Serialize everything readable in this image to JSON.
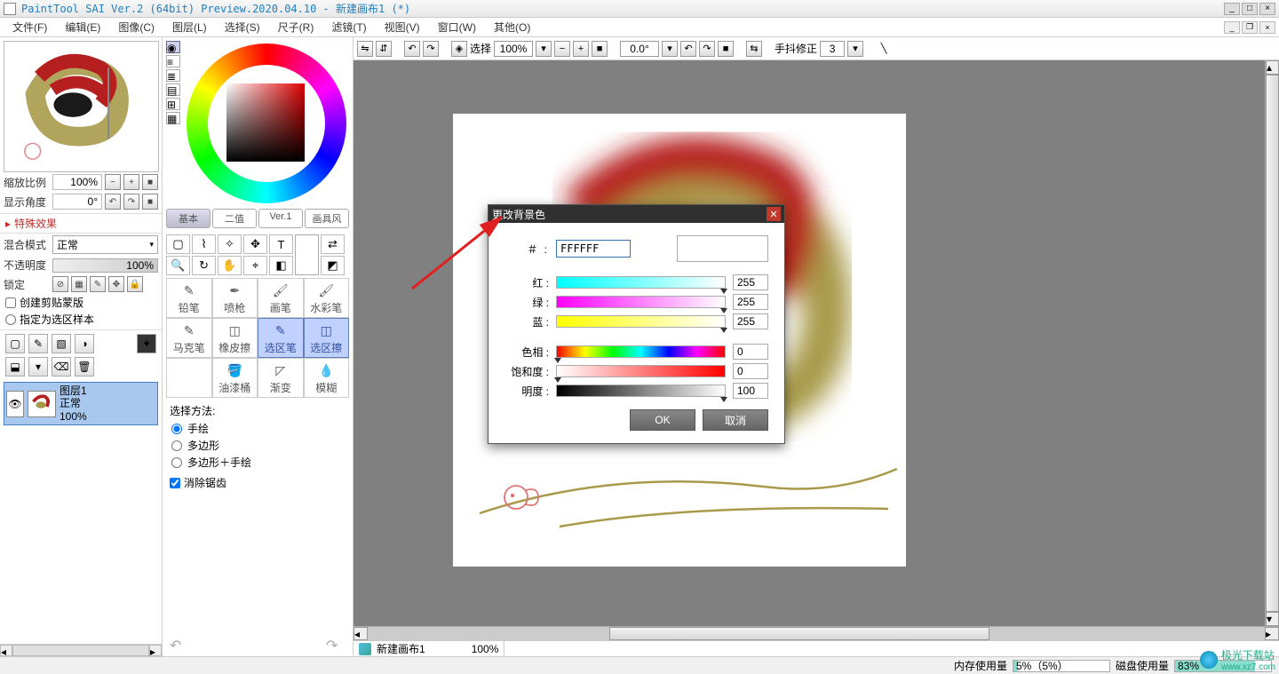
{
  "titlebar": {
    "title": "PaintTool SAI Ver.2 (64bit) Preview.2020.04.10 - 新建画布1 (*)"
  },
  "menu": {
    "file": "文件(F)",
    "edit": "编辑(E)",
    "image": "图像(C)",
    "layer": "图层(L)",
    "select": "选择(S)",
    "ruler": "尺子(R)",
    "filter": "滤镜(T)",
    "view": "视图(V)",
    "window": "窗口(W)",
    "others": "其他(O)"
  },
  "nav": {
    "zoom_label": "缩放比例",
    "zoom_value": "100%",
    "angle_label": "显示角度",
    "angle_value": "0°",
    "special_effects": "特殊效果",
    "blend_label": "混合模式",
    "blend_value": "正常",
    "opacity_label": "不透明度",
    "opacity_value": "100%",
    "lock_label": "锁定",
    "clip_label": "创建剪贴蒙版",
    "selsample_label": "指定为选区样本"
  },
  "layer": {
    "name": "图层1",
    "mode": "正常",
    "opacity": "100%"
  },
  "color_tabs": {
    "basic": "基本",
    "binary": "二值",
    "ver1": "Ver.1",
    "brushstyle": "画具风"
  },
  "brushes": {
    "r1": [
      "铅笔",
      "喷枪",
      "画笔",
      "水彩笔"
    ],
    "r2": [
      "马克笔",
      "橡皮擦",
      "选区笔",
      "选区擦"
    ],
    "r3": [
      "",
      "油漆桶",
      "渐变",
      "模糊"
    ]
  },
  "select": {
    "title": "选择方法:",
    "freehand": "手绘",
    "polygon": "多边形",
    "polyfh": "多边形＋手绘",
    "antialias": "消除锯齿"
  },
  "canvas_tb": {
    "select_label": "选择",
    "zoom": "100%",
    "angle": "0.0°",
    "stab_label": "手抖修正",
    "stab_value": "3"
  },
  "doc_tab": {
    "name": "新建画布1",
    "zoom": "100%"
  },
  "dialog": {
    "title": "更改背景色",
    "hash": "＃ :",
    "hex": "FFFFFF",
    "red": "红 :",
    "green": "绿 :",
    "blue": "蓝 :",
    "hue": "色相 :",
    "sat": "饱和度 :",
    "val": "明度 :",
    "r": "255",
    "g": "255",
    "b": "255",
    "h": "0",
    "s": "0",
    "v": "100",
    "ok": "OK",
    "cancel": "取消"
  },
  "status": {
    "mem_label": "内存使用量",
    "mem_text": "5%（5%）",
    "mem_pct": 5,
    "disk_label": "磁盘使用量",
    "disk_text": "83%",
    "disk_pct": 83
  },
  "watermark": {
    "text": "极光下载站",
    "url": "www.xz7.com"
  }
}
